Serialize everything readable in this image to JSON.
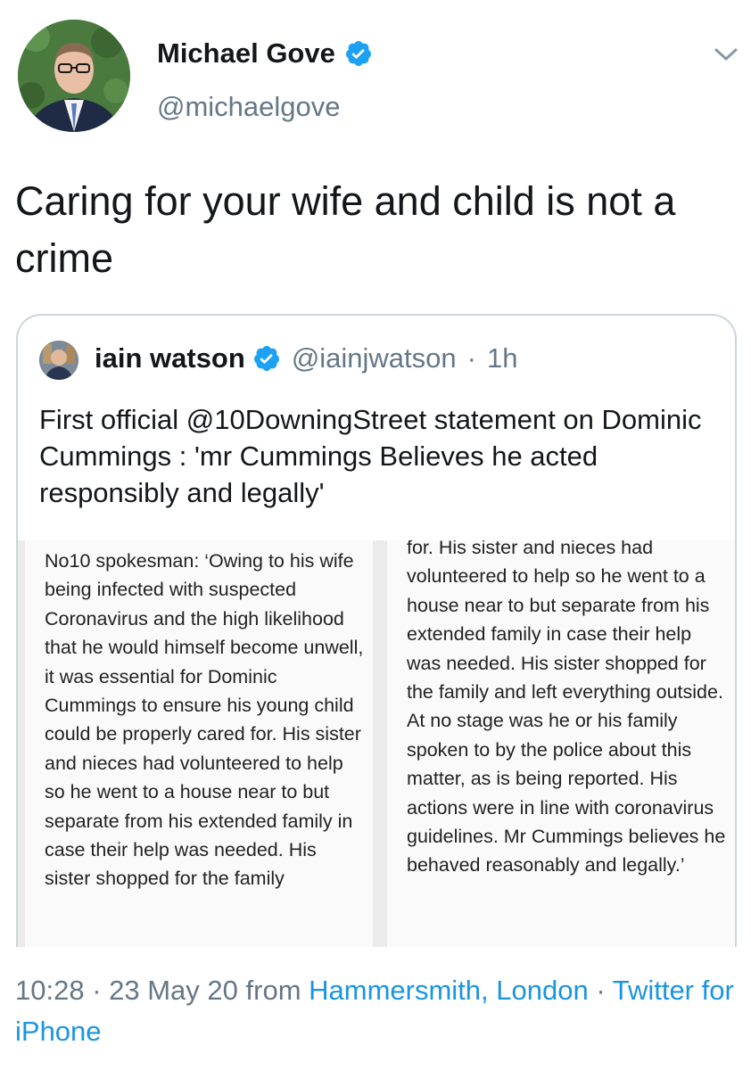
{
  "tweet": {
    "author": {
      "name": "Michael Gove",
      "handle": "@michaelgove",
      "verified": true,
      "avatar_icon": "profile-photo"
    },
    "menu_icon": "chevron-down-icon",
    "text": "Caring for your wife and child is not a crime",
    "quoted_tweet": {
      "author": {
        "name": "iain watson",
        "handle": "@iainjwatson",
        "verified": true,
        "avatar_icon": "profile-photo"
      },
      "separator": "·",
      "time": "1h",
      "text": "First official @10DowningStreet statement on Dominic Cummings : 'mr Cummings Believes he acted responsibly and legally'",
      "image": {
        "left_column": "No10 spokesman: ‘Owing to his wife being infected with suspected Coronavirus and the high likelihood that he would himself become unwell, it was essential for Dominic Cummings to ensure his young child could be properly cared for. His sister and nieces had volunteered to help so he went to a house near to but separate from his extended family in case their help was needed. His sister shopped for the family",
        "right_column": "for. His sister and nieces had volunteered to help so he went to a house near to but separate from his extended family in case their help was needed. His sister shopped for the family and left everything outside. At no stage was he or his family spoken to by the police about this matter, as is being reported. His actions were in line with coronavirus guidelines. Mr Cummings believes he behaved reasonably and legally.’"
      }
    },
    "footer": {
      "time": "10:28",
      "sep1": " · ",
      "date": "23 May 20",
      "from": " from ",
      "location": "Hammersmith, London",
      "sep2": " · ",
      "source": "Twitter for iPhone"
    },
    "colors": {
      "verified": "#1da1f2",
      "link": "#1b95e0",
      "secondary_text": "#657786"
    }
  }
}
